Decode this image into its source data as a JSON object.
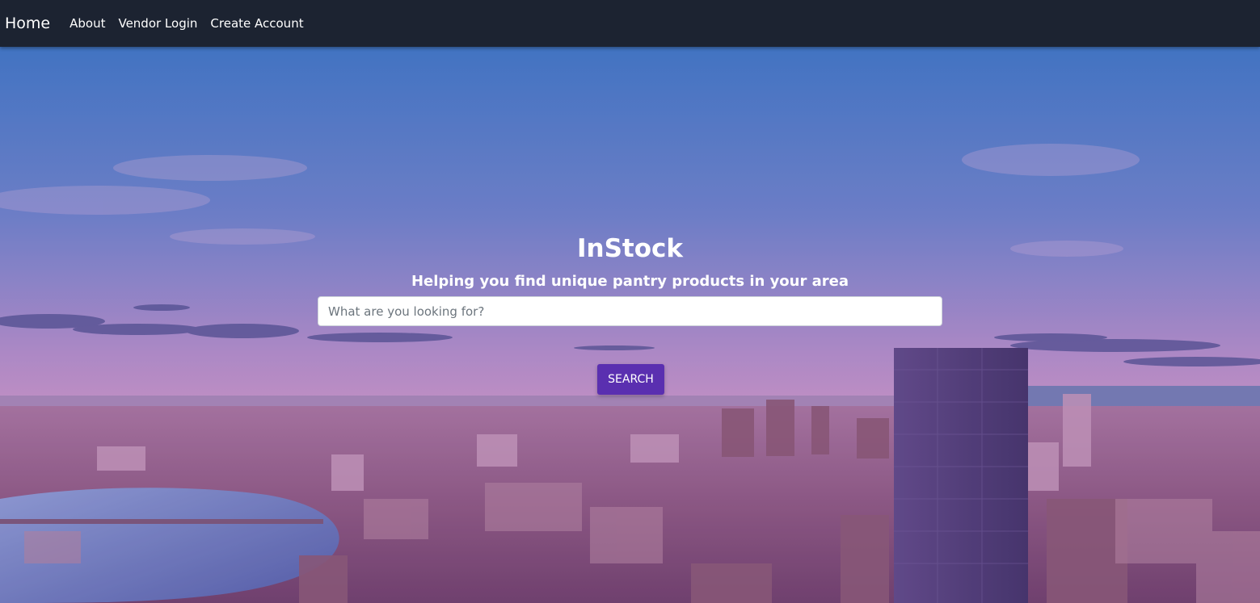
{
  "nav": {
    "brand": "Home",
    "links": [
      "About",
      "Vendor Login",
      "Create Account"
    ]
  },
  "hero": {
    "title": "InStock",
    "subtitle": "Helping you find unique pantry products in your area",
    "search_placeholder": "What are you looking for?",
    "search_button": "SEARCH"
  },
  "colors": {
    "navbar": "#1c2331",
    "accent": "#5a2fb0",
    "sky_top": "#3a7bc8",
    "sky_horizon": "#cf9ac8"
  }
}
